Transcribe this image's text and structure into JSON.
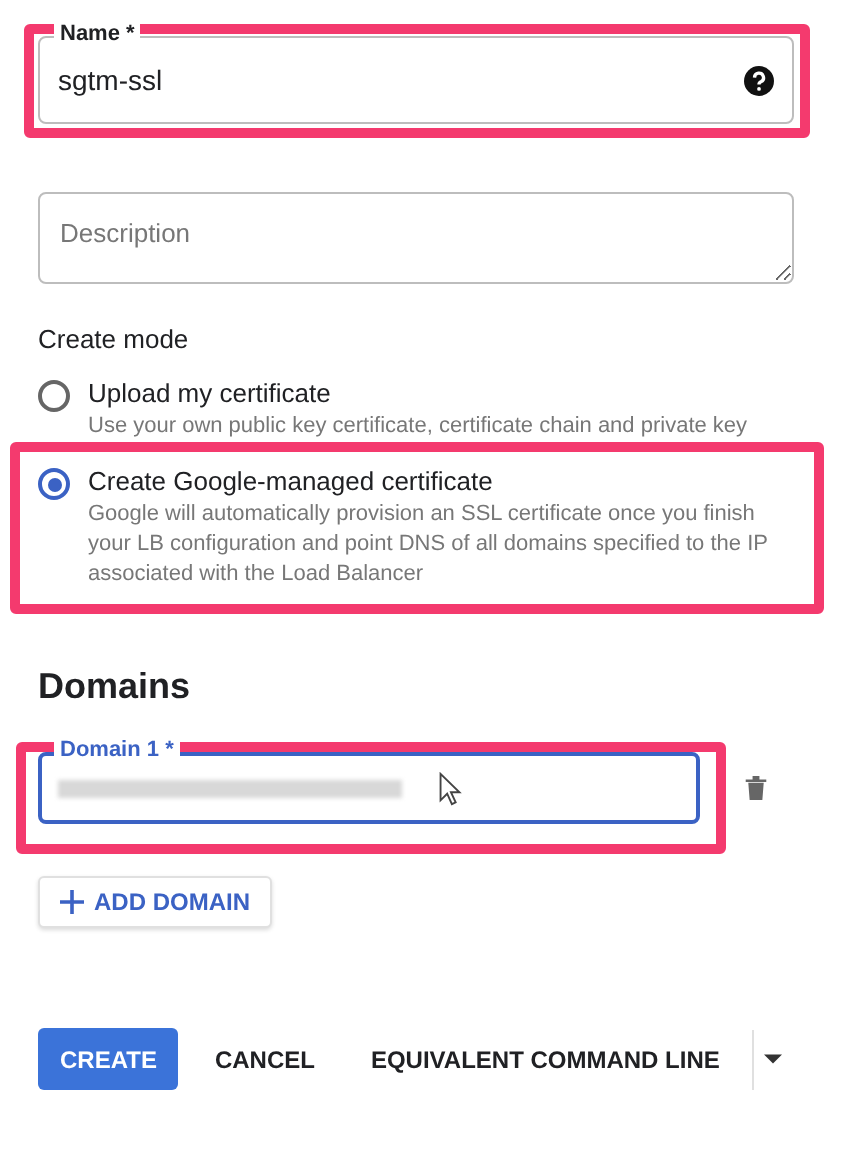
{
  "name_field": {
    "label": "Name *",
    "value": "sgtm-ssl",
    "highlighted": true
  },
  "description_field": {
    "placeholder": "Description"
  },
  "create_mode": {
    "title": "Create mode",
    "options": [
      {
        "label": "Upload my certificate",
        "description": "Use your own public key certificate, certificate chain and private key",
        "selected": false,
        "highlighted": false
      },
      {
        "label": "Create Google-managed certificate",
        "description": "Google will automatically provision an SSL certificate once you finish your LB configuration and point DNS of all domains specified to the IP associated with the Load Balancer",
        "selected": true,
        "highlighted": true
      }
    ]
  },
  "domains": {
    "title": "Domains",
    "fields": [
      {
        "label": "Domain 1 *",
        "highlighted": true,
        "focused": true
      }
    ],
    "add_button": "ADD DOMAIN"
  },
  "actions": {
    "create": "CREATE",
    "cancel": "CANCEL",
    "command_line": "EQUIVALENT COMMAND LINE"
  }
}
